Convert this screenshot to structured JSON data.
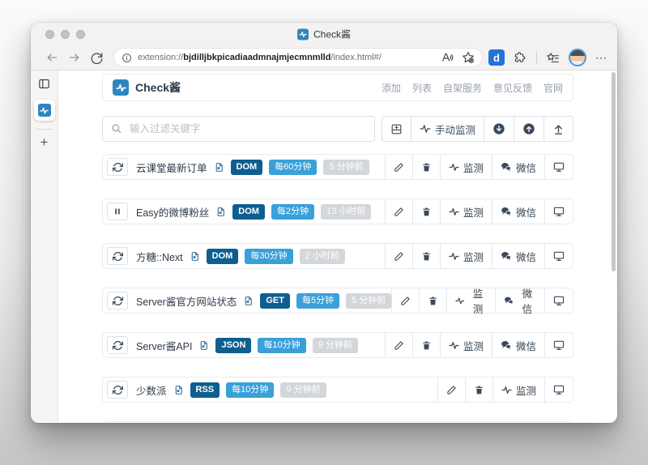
{
  "browser": {
    "tab_title": "Check酱",
    "url": {
      "prefix": "extension://",
      "domain": "bjdilljbkpicadiaadmnajmjecmnmlld",
      "path": "/index.html#/"
    },
    "extension_badge_letter": "d",
    "menu_label": "⋯"
  },
  "sidebar": {
    "new_tab_label": "+"
  },
  "app": {
    "logo_text": "Check酱",
    "nav": [
      "添加",
      "列表",
      "自架服务",
      "意见反馈",
      "官网"
    ],
    "controls": {
      "search_placeholder": "输入过滤关键字",
      "manual_monitor_label": "手动监测"
    },
    "actions": {
      "monitor": "监测",
      "wechat": "微信"
    },
    "rows": [
      {
        "state": "running",
        "title": "云课堂最新订单",
        "type": "DOM",
        "interval": "每60分钟",
        "last": "5 分钟前",
        "wechat": true
      },
      {
        "state": "paused",
        "title": "Easy的微博粉丝",
        "type": "DOM",
        "interval": "每2分钟",
        "last": "13 小时前",
        "wechat": true
      },
      {
        "state": "running",
        "title": "方糖::Next",
        "type": "DOM",
        "interval": "每30分钟",
        "last": "2 小时前",
        "wechat": true
      },
      {
        "state": "running",
        "title": "Server酱官方网站状态",
        "type": "GET",
        "interval": "每5分钟",
        "last": "5 分钟前",
        "wechat": true
      },
      {
        "state": "running",
        "title": "Server酱API",
        "type": "JSON",
        "interval": "每10分钟",
        "last": "9 分钟前",
        "wechat": true
      },
      {
        "state": "running",
        "title": "少数派",
        "type": "RSS",
        "interval": "每10分钟",
        "last": "9 分钟前",
        "wechat": false
      }
    ]
  },
  "colors": {
    "accent": "#2e86c1",
    "badge_type": "#0f5e90",
    "badge_interval": "#3aa0d8",
    "badge_time": "#d3d6da",
    "icon_dark": "#3a4a5c"
  }
}
